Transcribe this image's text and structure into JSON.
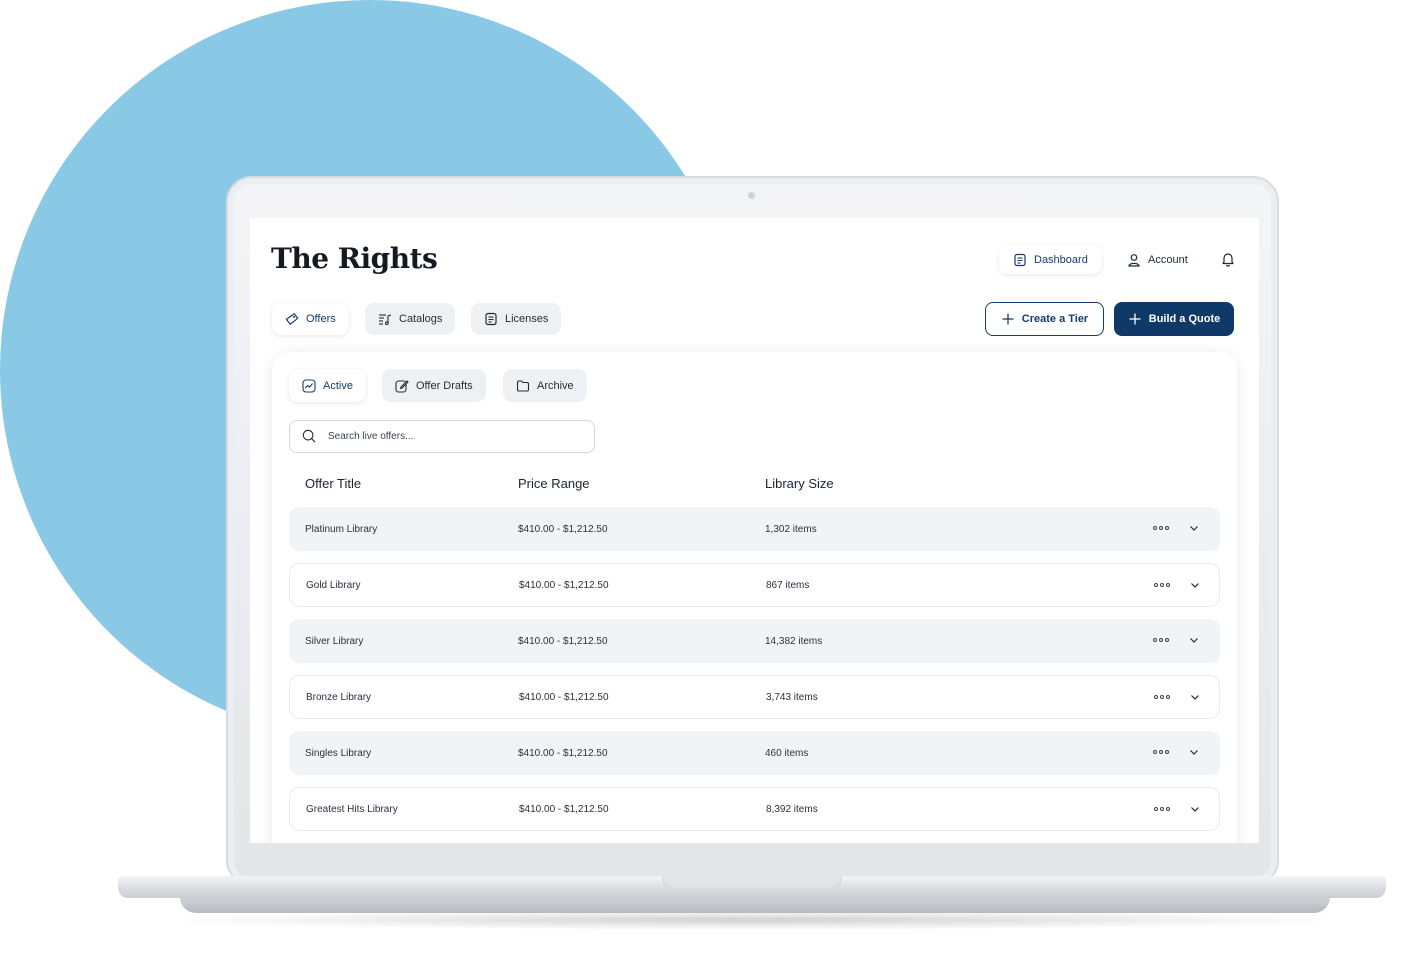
{
  "app": {
    "logo": "The Rights"
  },
  "header": {
    "dashboard_label": "Dashboard",
    "account_label": "Account"
  },
  "nav_tabs": [
    {
      "label": "Offers",
      "icon": "tag-icon",
      "selected": true
    },
    {
      "label": "Catalogs",
      "icon": "music-list-icon",
      "selected": false
    },
    {
      "label": "Licenses",
      "icon": "document-icon",
      "selected": false
    }
  ],
  "actions": {
    "create_tier_label": "Create a Tier",
    "build_quote_label": "Build a Quote"
  },
  "sub_tabs": [
    {
      "label": "Active",
      "icon": "trend-icon",
      "selected": true
    },
    {
      "label": "Offer Drafts",
      "icon": "edit-icon",
      "selected": false
    },
    {
      "label": "Archive",
      "icon": "folder-icon",
      "selected": false
    }
  ],
  "search": {
    "placeholder": "Search live offers..."
  },
  "table": {
    "columns": [
      "Offer Title",
      "Price Range",
      "Library Size"
    ],
    "rows": [
      {
        "title": "Platinum Library",
        "price": "$410.00 - $1,212.50",
        "size": "1,302 items"
      },
      {
        "title": "Gold Library",
        "price": "$410.00 - $1,212.50",
        "size": "867 items"
      },
      {
        "title": "Silver Library",
        "price": "$410.00 - $1,212.50",
        "size": "14,382 items"
      },
      {
        "title": "Bronze Library",
        "price": "$410.00 - $1,212.50",
        "size": "3,743 items"
      },
      {
        "title": "Singles Library",
        "price": "$410.00 - $1,212.50",
        "size": "460 items"
      },
      {
        "title": "Greatest Hits Library",
        "price": "$410.00 - $1,212.50",
        "size": "8,392 items"
      }
    ]
  },
  "colors": {
    "accent": "#0f3a68",
    "background_circle": "#89c9e5",
    "row_shade": "#f1f4f7"
  }
}
